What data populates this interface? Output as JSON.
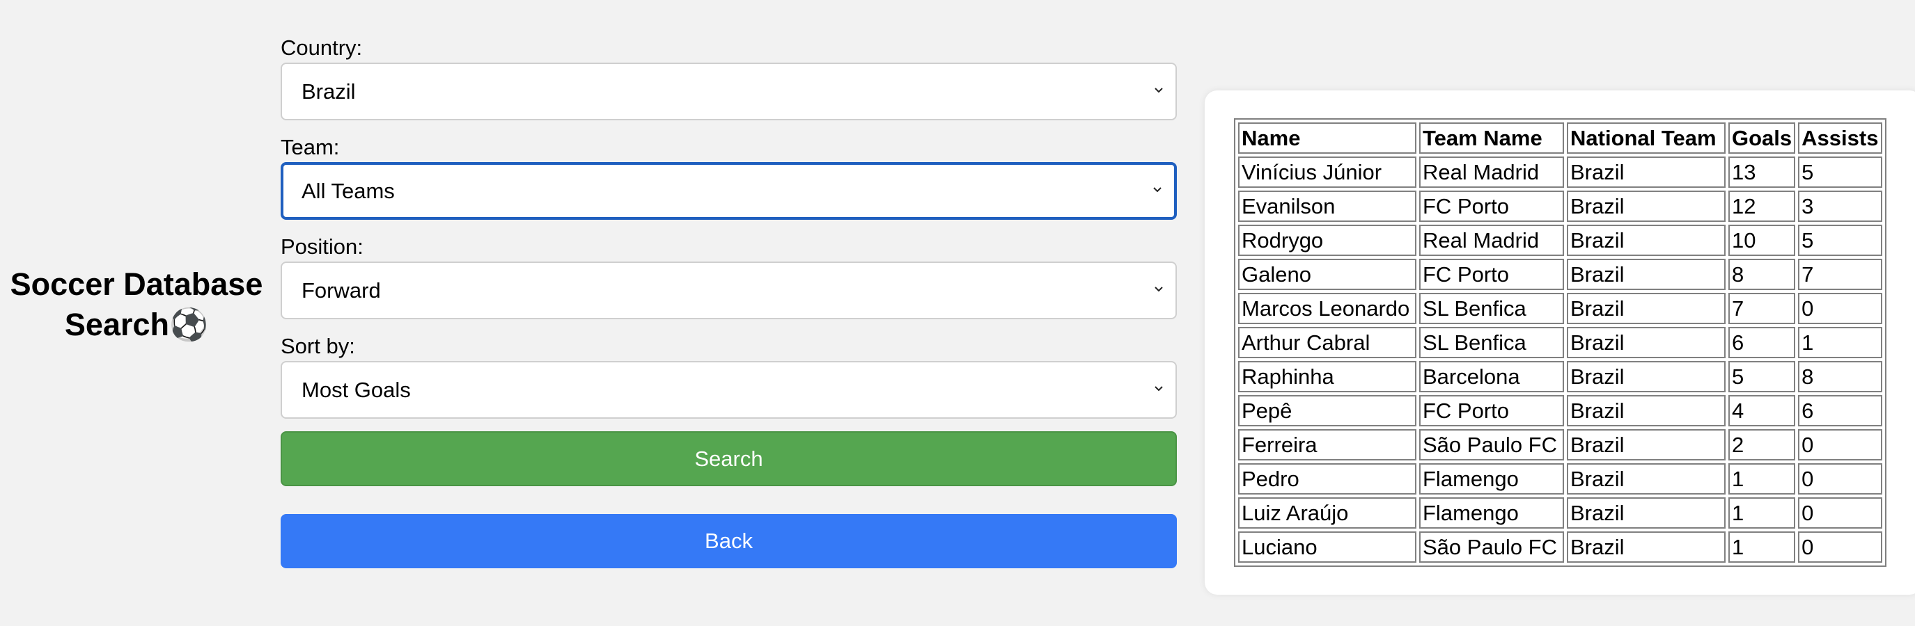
{
  "page": {
    "title": "Soccer Database Search",
    "title_emoji": "⚽"
  },
  "form": {
    "country": {
      "label": "Country:",
      "value": "Brazil"
    },
    "team": {
      "label": "Team:",
      "value": "All Teams"
    },
    "position": {
      "label": "Position:",
      "value": "Forward"
    },
    "sort": {
      "label": "Sort by:",
      "value": "Most Goals"
    },
    "search_label": "Search",
    "back_label": "Back"
  },
  "results": {
    "headers": [
      "Name",
      "Team Name",
      "National Team",
      "Goals",
      "Assists"
    ],
    "rows": [
      [
        "Vinícius Júnior",
        "Real Madrid",
        "Brazil",
        "13",
        "5"
      ],
      [
        "Evanilson",
        "FC Porto",
        "Brazil",
        "12",
        "3"
      ],
      [
        "Rodrygo",
        "Real Madrid",
        "Brazil",
        "10",
        "5"
      ],
      [
        "Galeno",
        "FC Porto",
        "Brazil",
        "8",
        "7"
      ],
      [
        "Marcos Leonardo",
        "SL Benfica",
        "Brazil",
        "7",
        "0"
      ],
      [
        "Arthur Cabral",
        "SL Benfica",
        "Brazil",
        "6",
        "1"
      ],
      [
        "Raphinha",
        "Barcelona",
        "Brazil",
        "5",
        "8"
      ],
      [
        "Pepê",
        "FC Porto",
        "Brazil",
        "4",
        "6"
      ],
      [
        "Ferreira",
        "São Paulo FC",
        "Brazil",
        "2",
        "0"
      ],
      [
        "Pedro",
        "Flamengo",
        "Brazil",
        "1",
        "0"
      ],
      [
        "Luiz Araújo",
        "Flamengo",
        "Brazil",
        "1",
        "0"
      ],
      [
        "Luciano",
        "São Paulo FC",
        "Brazil",
        "1",
        "0"
      ]
    ]
  },
  "colors": {
    "background": "#f2f2f2",
    "search_button": "#55a650",
    "back_button": "#3579f6",
    "focus_border": "#1f5fbf"
  },
  "icons": {
    "select_arrow": "chevron-down-icon",
    "title_emoji": "soccer-ball-icon"
  }
}
